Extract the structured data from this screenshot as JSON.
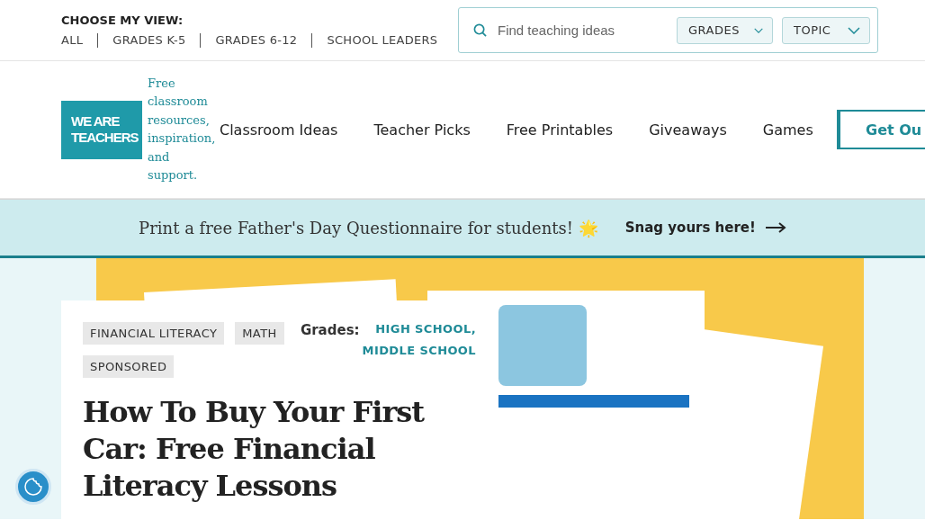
{
  "view_switcher": {
    "heading": "CHOOSE MY VIEW:",
    "options": [
      {
        "label": "ALL"
      },
      {
        "label": "GRADES K-5"
      },
      {
        "label": "GRADES 6-12"
      },
      {
        "label": "SCHOOL LEADERS"
      }
    ]
  },
  "search": {
    "placeholder": "Find teaching ideas",
    "filters": [
      {
        "label": "GRADES"
      },
      {
        "label": "TOPIC"
      }
    ]
  },
  "header": {
    "logo": {
      "line_1": "WE ARE",
      "line_2": "TEACHERS"
    },
    "tagline": "Free classroom resources, inspiration, and support.",
    "nav": [
      {
        "label": "Classroom Ideas"
      },
      {
        "label": "Teacher Picks"
      },
      {
        "label": "Free Printables"
      },
      {
        "label": "Giveaways"
      },
      {
        "label": "Games"
      }
    ],
    "cta": "Get Ou"
  },
  "banner": {
    "text": "Print a free Father's Day Questionnaire for students! 🌟",
    "link": "Snag yours here!"
  },
  "article": {
    "tags": [
      {
        "label": "FINANCIAL LITERACY"
      },
      {
        "label": "MATH"
      },
      {
        "label": "SPONSORED"
      }
    ],
    "grades_label": "Grades:",
    "grades": [
      {
        "label": "HIGH SCHOOL,"
      },
      {
        "label": "MIDDLE SCHOOL"
      }
    ],
    "title": "How To Buy Your First Car: Free Financial Literacy Lessons"
  }
}
